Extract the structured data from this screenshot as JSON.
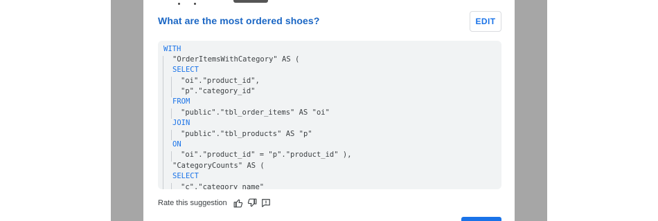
{
  "suggestion": {
    "title": "What are the most ordered shoes?",
    "edit_label": "EDIT"
  },
  "code": {
    "lines": [
      "WITH",
      "\"OrderItemsWithCategory\" AS (",
      "SELECT",
      "\"oi\".\"product_id\",",
      "\"p\".\"category_id\"",
      "FROM",
      "\"public\".\"tbl_order_items\" AS \"oi\"",
      "JOIN",
      "\"public\".\"tbl_products\" AS \"p\"",
      "ON",
      "\"oi\".\"product_id\" = \"p\".\"product_id\" ),",
      "\"CategoryCounts\" AS (",
      "SELECT",
      "\"c\".\"category_name\""
    ]
  },
  "feedback": {
    "label": "Rate this suggestion",
    "icons": [
      "thumbs-up-icon",
      "thumbs-down-icon",
      "report-icon"
    ]
  },
  "colors": {
    "accent": "#1a73e8",
    "keyword": "#1a73e8",
    "code_background": "#f1f3f4",
    "side_gray": "#a6a6a6"
  }
}
